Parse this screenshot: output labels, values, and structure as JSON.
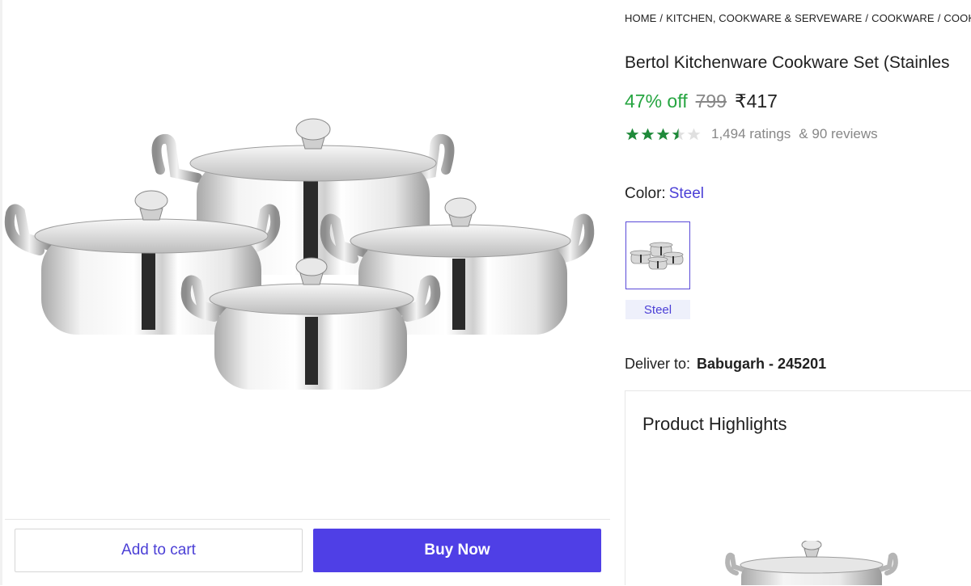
{
  "breadcrumb": {
    "items": [
      "HOME",
      "KITCHEN, COOKWARE & SERVEWARE",
      "COOKWARE",
      "COOKW"
    ],
    "separator": "/"
  },
  "product": {
    "title": "Bertol Kitchenware Cookware Set (Stainles",
    "discount": "47% off",
    "mrp": "799",
    "price": "₹417",
    "rating": 3.5,
    "rating_max": 5,
    "ratings_count": "1,494 ratings",
    "reviews_count": "& 90 reviews"
  },
  "color": {
    "label": "Color:",
    "value": "Steel",
    "options": [
      {
        "name": "Steel",
        "selected": true
      }
    ]
  },
  "delivery": {
    "label": "Deliver to:",
    "location": "Babugarh - 245201"
  },
  "highlights": {
    "title": "Product Highlights"
  },
  "actions": {
    "add_to_cart": "Add to cart",
    "buy_now": "Buy Now"
  },
  "colors": {
    "accent": "#4f3fe6",
    "discount_green": "#26a541",
    "star_green": "#1f8a3a",
    "muted_text": "#878787"
  },
  "icons": [
    "star-filled-icon",
    "star-half-icon",
    "star-empty-icon"
  ]
}
